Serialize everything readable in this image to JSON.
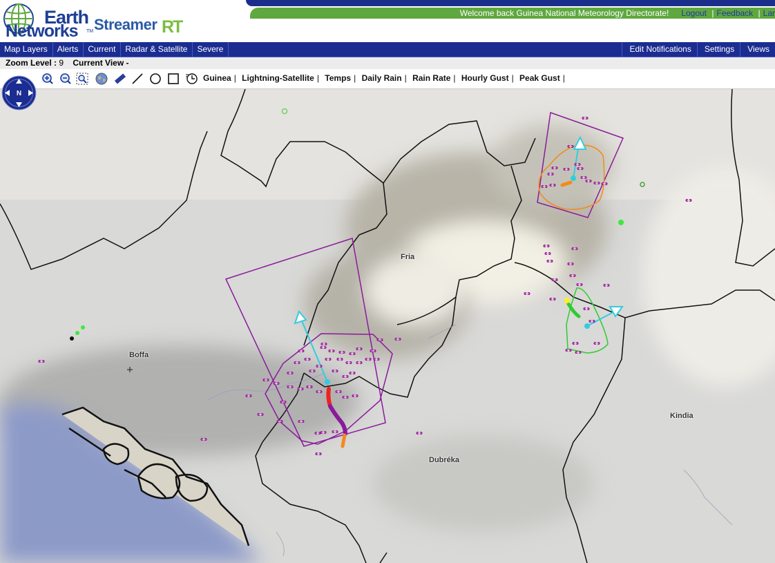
{
  "app": {
    "brand_line1": "Earth",
    "brand_line2": "Networks",
    "brand_tm": "TM",
    "product": "Streamer",
    "product_suffix": "RT"
  },
  "header": {
    "welcome": "Welcome back  Guinea National Meteorology Directorate!",
    "links": [
      "Logout",
      "Feedback",
      "Lar"
    ]
  },
  "nav": {
    "left": [
      "Map Layers",
      "Alerts",
      "Current",
      "Radar & Satellite",
      "Severe"
    ],
    "right": [
      "Edit Notifications",
      "Settings",
      "Views"
    ]
  },
  "status": {
    "zoom_label": "Zoom Level :",
    "zoom_value": "9",
    "view_label": "Current View -"
  },
  "toolbar": {
    "tools": [
      "zoom-in-icon",
      "zoom-out-icon",
      "zoom-box-icon",
      "globe-icon",
      "ruler-icon",
      "line-draw-icon",
      "circle-draw-icon",
      "rectangle-draw-icon",
      "clock-icon"
    ],
    "layers": [
      "Guinea",
      "Lightning-Satellite",
      "Temps",
      "Daily Rain",
      "Rain Rate",
      "Hourly Gust",
      "Peak Gust"
    ]
  },
  "map": {
    "cities": [
      "Fria",
      "Boffa",
      "Dubréka",
      "Kindia"
    ],
    "colors": {
      "cell_polygon": "#8a1a9a",
      "track_arrow": "#33ccdd",
      "lightning_cg": "#ff1a1a",
      "lightning_ic": "#9a1a9a",
      "ocean": "#8c9ac8",
      "border": "#000000"
    }
  }
}
